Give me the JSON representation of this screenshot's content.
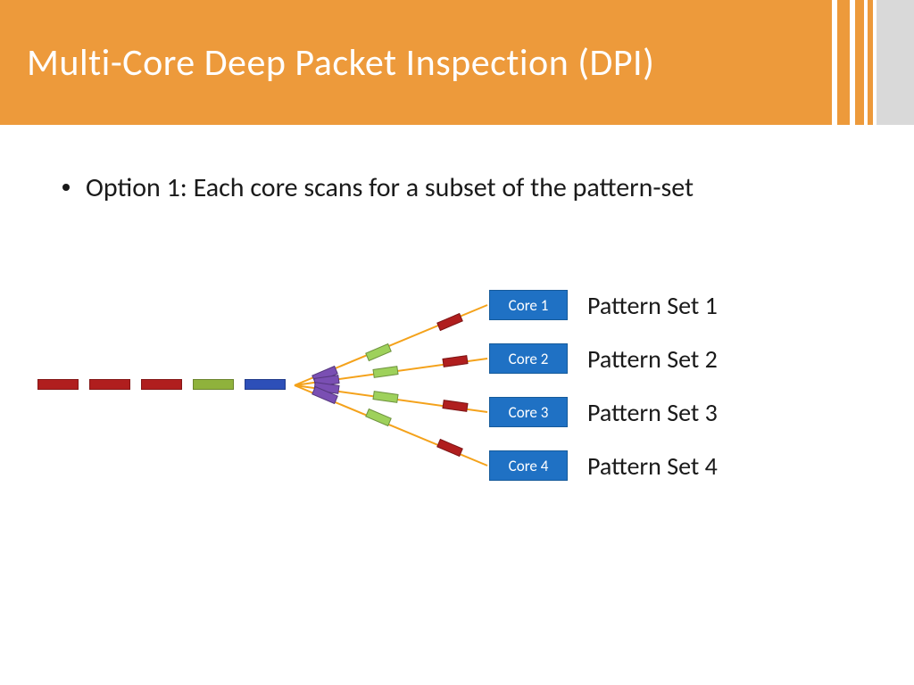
{
  "header": {
    "title": "Multi-Core Deep Packet Inspection (DPI)"
  },
  "bullet": {
    "text": "Option 1:  Each core scans for a subset of the pattern-set"
  },
  "cores": [
    {
      "label": "Core 1",
      "pattern": "Pattern Set 1"
    },
    {
      "label": "Core 2",
      "pattern": "Pattern Set 2"
    },
    {
      "label": "Core 3",
      "pattern": "Pattern Set 3"
    },
    {
      "label": "Core 4",
      "pattern": "Pattern Set 4"
    }
  ]
}
